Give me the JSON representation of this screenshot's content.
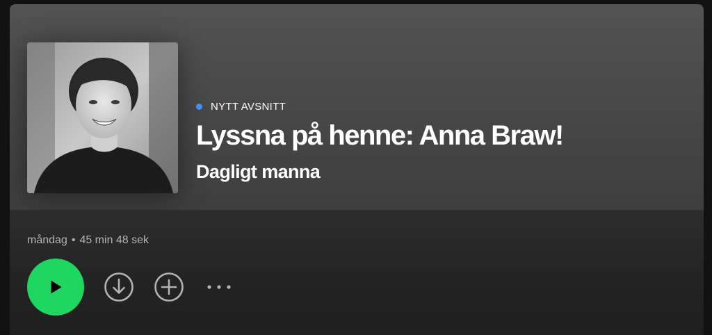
{
  "episode": {
    "badge": "NYTT AVSNITT",
    "title": "Lyssna på henne: Anna Braw!",
    "show": "Dagligt manna",
    "cover_alt": "Anna Braw portrait",
    "day": "måndag",
    "separator": "•",
    "duration": "45 min 48 sek"
  },
  "controls": {
    "play_icon": "play-icon",
    "download_icon": "download-icon",
    "add_icon": "add-icon",
    "more_icon": "more-icon"
  },
  "colors": {
    "accent": "#1ed760",
    "badge_dot": "#3d91f4",
    "text_primary": "#ffffff",
    "text_secondary": "#b3b3b3"
  }
}
